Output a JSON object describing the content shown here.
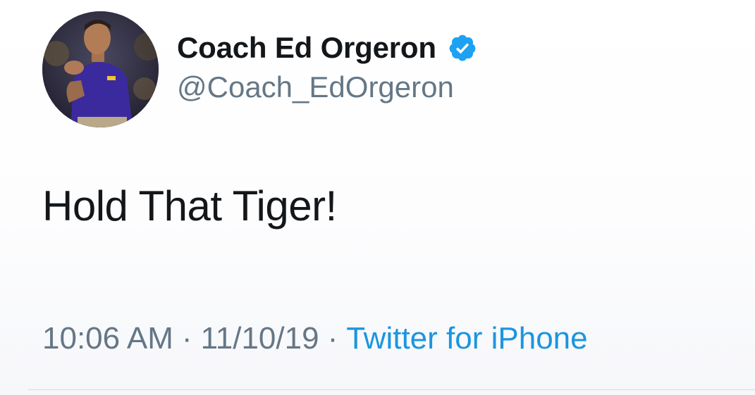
{
  "tweet": {
    "author": {
      "display_name": "Coach Ed Orgeron",
      "handle": "@Coach_EdOrgeron",
      "verified": true,
      "verified_color": "#1da1f2"
    },
    "text": "Hold That Tiger!",
    "meta": {
      "time": "10:06 AM",
      "separator": "·",
      "date": "11/10/19",
      "source": "Twitter for iPhone"
    }
  },
  "colors": {
    "name_text": "#14171a",
    "secondary_text": "#657786",
    "link": "#1b95e0",
    "divider": "#d6dbe0"
  }
}
